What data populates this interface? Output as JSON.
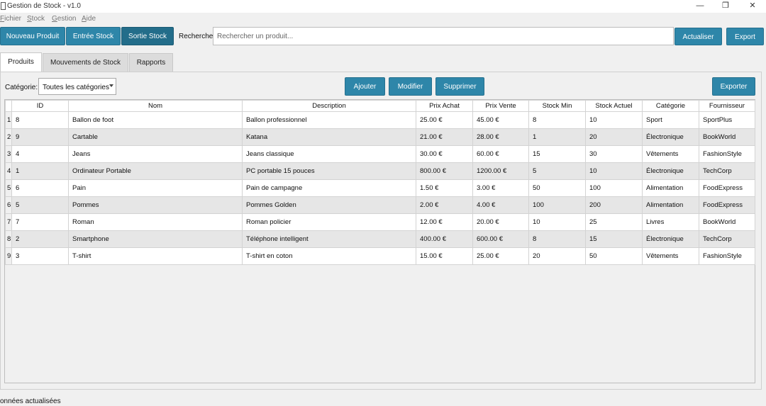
{
  "window": {
    "title": "Gestion de Stock - v1.0",
    "controls": {
      "minimize": "—",
      "maximize": "❐",
      "close": "✕"
    }
  },
  "menu": [
    {
      "label": "Fichier",
      "mnemonic": "F"
    },
    {
      "label": "Stock",
      "mnemonic": "S"
    },
    {
      "label": "Gestion",
      "mnemonic": "G"
    },
    {
      "label": "Aide",
      "mnemonic": "A"
    }
  ],
  "toolbar": {
    "new_product": "Nouveau Produit",
    "stock_in": "Entrée Stock",
    "stock_out": "Sortie Stock",
    "search_label": "Recherche:",
    "search_placeholder": "Rechercher un produit...",
    "refresh": "Actualiser",
    "export": "Export"
  },
  "tabs": [
    {
      "label": "Produits",
      "active": true
    },
    {
      "label": "Mouvements de Stock",
      "active": false
    },
    {
      "label": "Rapports",
      "active": false
    }
  ],
  "products_panel": {
    "category_label": "Catégorie:",
    "category_selected": "Toutes les catégories",
    "add": "Ajouter",
    "edit": "Modifier",
    "delete": "Supprimer",
    "export": "Exporter"
  },
  "table": {
    "columns": [
      "ID",
      "Nom",
      "Description",
      "Prix Achat",
      "Prix Vente",
      "Stock Min",
      "Stock Actuel",
      "Catégorie",
      "Fournisseur"
    ],
    "rows": [
      [
        "1",
        "8",
        "Ballon de foot",
        "Ballon professionnel",
        "25.00 €",
        "45.00 €",
        "8",
        "10",
        "Sport",
        "SportPlus"
      ],
      [
        "2",
        "9",
        "Cartable",
        "Katana",
        "21.00 €",
        "28.00 €",
        "1",
        "20",
        "Électronique",
        "BookWorld"
      ],
      [
        "3",
        "4",
        "Jeans",
        "Jeans classique",
        "30.00 €",
        "60.00 €",
        "15",
        "30",
        "Vêtements",
        "FashionStyle"
      ],
      [
        "4",
        "1",
        "Ordinateur Portable",
        "PC portable 15 pouces",
        "800.00 €",
        "1200.00 €",
        "5",
        "10",
        "Électronique",
        "TechCorp"
      ],
      [
        "5",
        "6",
        "Pain",
        "Pain de campagne",
        "1.50 €",
        "3.00 €",
        "50",
        "100",
        "Alimentation",
        "FoodExpress"
      ],
      [
        "6",
        "5",
        "Pommes",
        "Pommes Golden",
        "2.00 €",
        "4.00 €",
        "100",
        "200",
        "Alimentation",
        "FoodExpress"
      ],
      [
        "7",
        "7",
        "Roman",
        "Roman policier",
        "12.00 €",
        "20.00 €",
        "10",
        "25",
        "Livres",
        "BookWorld"
      ],
      [
        "8",
        "2",
        "Smartphone",
        "Téléphone intelligent",
        "400.00 €",
        "600.00 €",
        "8",
        "15",
        "Électronique",
        "TechCorp"
      ],
      [
        "9",
        "3",
        "T-shirt",
        "T-shirt en coton",
        "15.00 €",
        "25.00 €",
        "20",
        "50",
        "Vêtements",
        "FashionStyle"
      ]
    ]
  },
  "status_bar": {
    "message": "onnées actualisées"
  },
  "colors": {
    "button": "#2e86a9",
    "button_pressed": "#236d8a",
    "row_alt": "#e6e6e6"
  }
}
